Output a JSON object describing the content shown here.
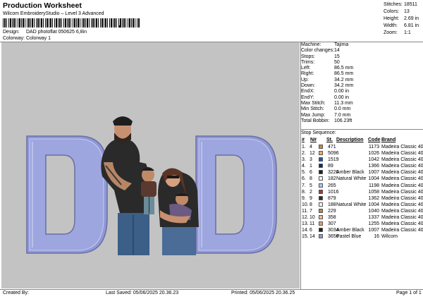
{
  "header": {
    "title": "Production Worksheet",
    "subtitle": "Wilcom EmbroideryStudio – Level 3 Advanced",
    "barcode_mark": ","
  },
  "design": {
    "label": "Design:",
    "value": "DAD photoflat 050625 6,8in"
  },
  "colorway": {
    "label": "Colorway:",
    "value": "Colorway 1"
  },
  "stats": [
    {
      "label": "Stitches:",
      "value": "18511"
    },
    {
      "label": "Colors:",
      "value": "13"
    },
    {
      "label": "Height:",
      "value": "2.69 in"
    },
    {
      "label": "Width:",
      "value": "6.81 in"
    },
    {
      "label": "Zoom:",
      "value": "1:1"
    }
  ],
  "specs": [
    {
      "label": "Machine:",
      "value": "Tajima"
    },
    {
      "label": "Color changes:",
      "value": "14"
    },
    {
      "label": "Stops:",
      "value": "15"
    },
    {
      "label": "Trims:",
      "value": "50"
    },
    {
      "label": "Left:",
      "value": "86.5 mm"
    },
    {
      "label": "Right:",
      "value": "86.5 mm"
    },
    {
      "label": "Up:",
      "value": "34.2 mm"
    },
    {
      "label": "Down:",
      "value": "34.2 mm"
    },
    {
      "label": "EndX:",
      "value": "0.00 in"
    },
    {
      "label": "EndY:",
      "value": "0.00 in"
    },
    {
      "label": "Max Stitch:",
      "value": "11.3 mm"
    },
    {
      "label": "Min Stitch:",
      "value": "0.0 mm"
    },
    {
      "label": "Max Jump:",
      "value": "7.0 mm"
    },
    {
      "label": "Total Bobbin:",
      "value": "106.23ft"
    }
  ],
  "sequence": {
    "title": "Stop Sequence:",
    "columns": {
      "hash": "#",
      "n": "N#",
      "st": "St.",
      "desc": "Description",
      "code": "Code",
      "brand": "Brand"
    },
    "rows": [
      {
        "idx": "1.",
        "n": "4",
        "color": "#c98a3c",
        "st": "471",
        "desc": "",
        "code": "1173",
        "brand": "Madeira Classic 40"
      },
      {
        "idx": "2.",
        "n": "12",
        "color": "#f2a66a",
        "st": "5096",
        "desc": "",
        "code": "1026",
        "brand": "Madeira Classic 40"
      },
      {
        "idx": "3.",
        "n": "3",
        "color": "#1e5aa0",
        "st": "1519",
        "desc": "",
        "code": "1042",
        "brand": "Madeira Classic 40"
      },
      {
        "idx": "4.",
        "n": "1",
        "color": "#17295a",
        "st": "89",
        "desc": "",
        "code": "1366",
        "brand": "Madeira Classic 40"
      },
      {
        "idx": "5.",
        "n": "6",
        "color": "#222222",
        "st": "3220",
        "desc": "Amber Black",
        "code": "1007",
        "brand": "Madeira Classic 40"
      },
      {
        "idx": "6.",
        "n": "8",
        "color": "#f4f4f4",
        "st": "182",
        "desc": "Natural White",
        "code": "1004",
        "brand": "Madeira Classic 40"
      },
      {
        "idx": "7.",
        "n": "5",
        "color": "#a9c8e8",
        "st": "265",
        "desc": "",
        "code": "1198",
        "brand": "Madeira Classic 40"
      },
      {
        "idx": "8.",
        "n": "2",
        "color": "#9c3a2a",
        "st": "1016",
        "desc": "",
        "code": "1058",
        "brand": "Madeira Classic 40"
      },
      {
        "idx": "9.",
        "n": "9",
        "color": "#3a2a1e",
        "st": "879",
        "desc": "",
        "code": "1362",
        "brand": "Madeira Classic 40"
      },
      {
        "idx": "10.",
        "n": "8",
        "color": "#f4f4f4",
        "st": "188",
        "desc": "Natural White",
        "code": "1004",
        "brand": "Madeira Classic 40"
      },
      {
        "idx": "11.",
        "n": "7",
        "color": "#b0855a",
        "st": "229",
        "desc": "",
        "code": "1040",
        "brand": "Madeira Classic 40"
      },
      {
        "idx": "12.",
        "n": "10",
        "color": "#e8bf9a",
        "st": "358",
        "desc": "",
        "code": "1337",
        "brand": "Madeira Classic 40"
      },
      {
        "idx": "13.",
        "n": "11",
        "color": "#d9a27c",
        "st": "307",
        "desc": "",
        "code": "1255",
        "brand": "Madeira Classic 40"
      },
      {
        "idx": "14.",
        "n": "6",
        "color": "#222222",
        "st": "3034",
        "desc": "Amber Black",
        "code": "1007",
        "brand": "Madeira Classic 40"
      },
      {
        "idx": "15.",
        "n": "14",
        "color": "#8f98d8",
        "st": "3656",
        "desc": "Pastel Blue",
        "code": "16",
        "brand": "Wilcom"
      }
    ]
  },
  "footer": {
    "created": "Created By:",
    "saved": "Last Saved: 05/06/2025 20.36.23",
    "printed": "Printed: 05/06/2025 20.36.25",
    "page": "Page 1 of 1"
  },
  "colors": {
    "canvas": "#c3c3c3",
    "letter": "#8f98d8"
  }
}
